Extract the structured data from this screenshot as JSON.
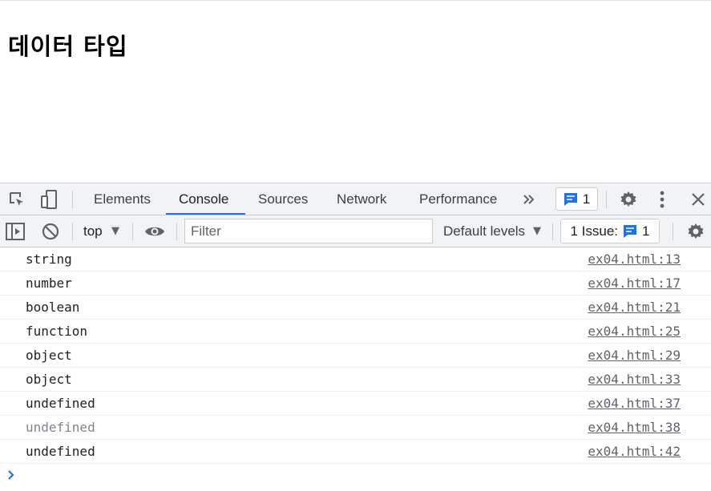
{
  "page": {
    "heading": "데이터 타입"
  },
  "devtools": {
    "tabs": [
      {
        "label": "Elements"
      },
      {
        "label": "Console"
      },
      {
        "label": "Sources"
      },
      {
        "label": "Network"
      },
      {
        "label": "Performance"
      }
    ],
    "active_tab": "Console",
    "message_count": "1",
    "toolbar": {
      "context": "top",
      "filter_placeholder": "Filter",
      "levels": "Default levels",
      "issue_label": "1 Issue:",
      "issue_count": "1"
    },
    "console_rows": [
      {
        "text": "string",
        "source": "ex04.html:13"
      },
      {
        "text": "number",
        "source": "ex04.html:17"
      },
      {
        "text": "boolean",
        "source": "ex04.html:21"
      },
      {
        "text": "function",
        "source": "ex04.html:25"
      },
      {
        "text": "object",
        "source": "ex04.html:29"
      },
      {
        "text": "object",
        "source": "ex04.html:33"
      },
      {
        "text": "undefined",
        "source": "ex04.html:37"
      },
      {
        "text": "undefined",
        "source": "ex04.html:38",
        "dimmed": true
      },
      {
        "text": "undefined",
        "source": "ex04.html:42"
      }
    ],
    "colors": {
      "accent": "#1a73e8",
      "badge_icon": "#1a73e8"
    }
  }
}
